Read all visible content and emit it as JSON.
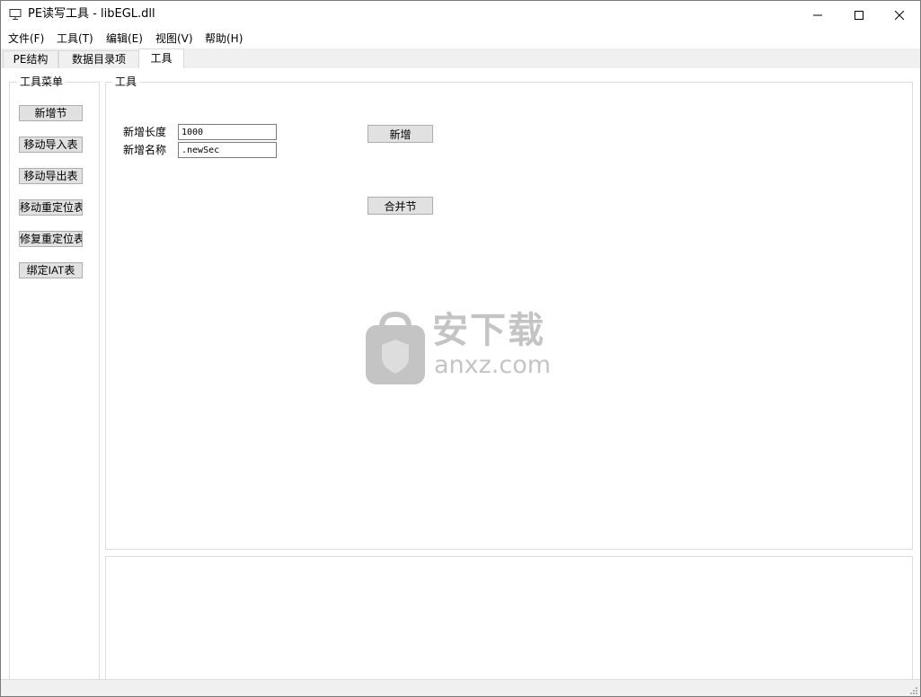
{
  "window": {
    "title": "PE读写工具 - libEGL.dll"
  },
  "menu": [
    {
      "label": "文件(F)"
    },
    {
      "label": "工具(T)"
    },
    {
      "label": "编辑(E)"
    },
    {
      "label": "视图(V)"
    },
    {
      "label": "帮助(H)"
    }
  ],
  "tabs": [
    {
      "label": "PE结构"
    },
    {
      "label": "数据目录项"
    },
    {
      "label": "工具",
      "active": true
    }
  ],
  "sidebar": {
    "title": "工具菜单",
    "buttons": [
      {
        "label": "新增节"
      },
      {
        "label": "移动导入表"
      },
      {
        "label": "移动导出表"
      },
      {
        "label": "移动重定位表"
      },
      {
        "label": "修复重定位表"
      },
      {
        "label": "绑定IAT表"
      }
    ]
  },
  "tools": {
    "title": "工具",
    "length_label": "新增长度",
    "length_value": "1000",
    "name_label": "新增名称",
    "name_value": ".newSec",
    "add_button": "新增",
    "merge_button": "合并节"
  },
  "watermark": {
    "text_cn": "安下载",
    "text_en": "anxz.com"
  },
  "colors": {
    "background": "#f0f0f0",
    "panel": "#ffffff",
    "button_face": "#e1e1e1",
    "border": "#dcdcdc"
  }
}
